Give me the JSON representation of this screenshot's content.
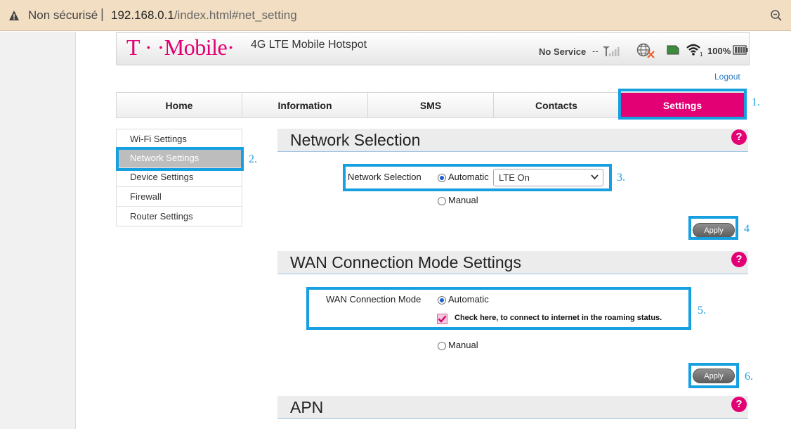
{
  "browser": {
    "security_label": "Non sécurisé",
    "separator": "|",
    "url_host": "192.168.0.1",
    "url_path": "/index.html#net_setting"
  },
  "header": {
    "logo": "T · ·Mobile·",
    "title": "4G LTE Mobile Hotspot",
    "status": {
      "network": "No Service",
      "dash": "--",
      "battery": "100%"
    },
    "logout": "Logout"
  },
  "tabs": [
    {
      "label": "Home"
    },
    {
      "label": "Information"
    },
    {
      "label": "SMS"
    },
    {
      "label": "Contacts"
    },
    {
      "label": "Settings",
      "active": true
    }
  ],
  "side_menu": [
    {
      "label": "Wi-Fi Settings"
    },
    {
      "label": "Network Settings",
      "active": true
    },
    {
      "label": "Device Settings"
    },
    {
      "label": "Firewall"
    },
    {
      "label": "Router Settings"
    }
  ],
  "network_selection": {
    "title": "Network Selection",
    "field_label": "Network Selection",
    "automatic_label": "Automatic",
    "manual_label": "Manual",
    "selected": "automatic",
    "dropdown_value": "LTE On",
    "apply_label": "Apply"
  },
  "wan": {
    "title": "WAN Connection Mode Settings",
    "field_label": "WAN Connection Mode",
    "automatic_label": "Automatic",
    "manual_label": "Manual",
    "selected": "automatic",
    "roaming_checked": true,
    "roaming_text": "Check here, to connect to internet in the roaming status.",
    "apply_label": "Apply"
  },
  "apn": {
    "title": "APN"
  },
  "help_glyph": "?",
  "annotations": [
    "1.",
    "2.",
    "3.",
    "4",
    "5.",
    "6."
  ],
  "colors": {
    "brand": "#e20074",
    "annotation": "#17a0e0",
    "address_bar": "#f2dec3"
  }
}
